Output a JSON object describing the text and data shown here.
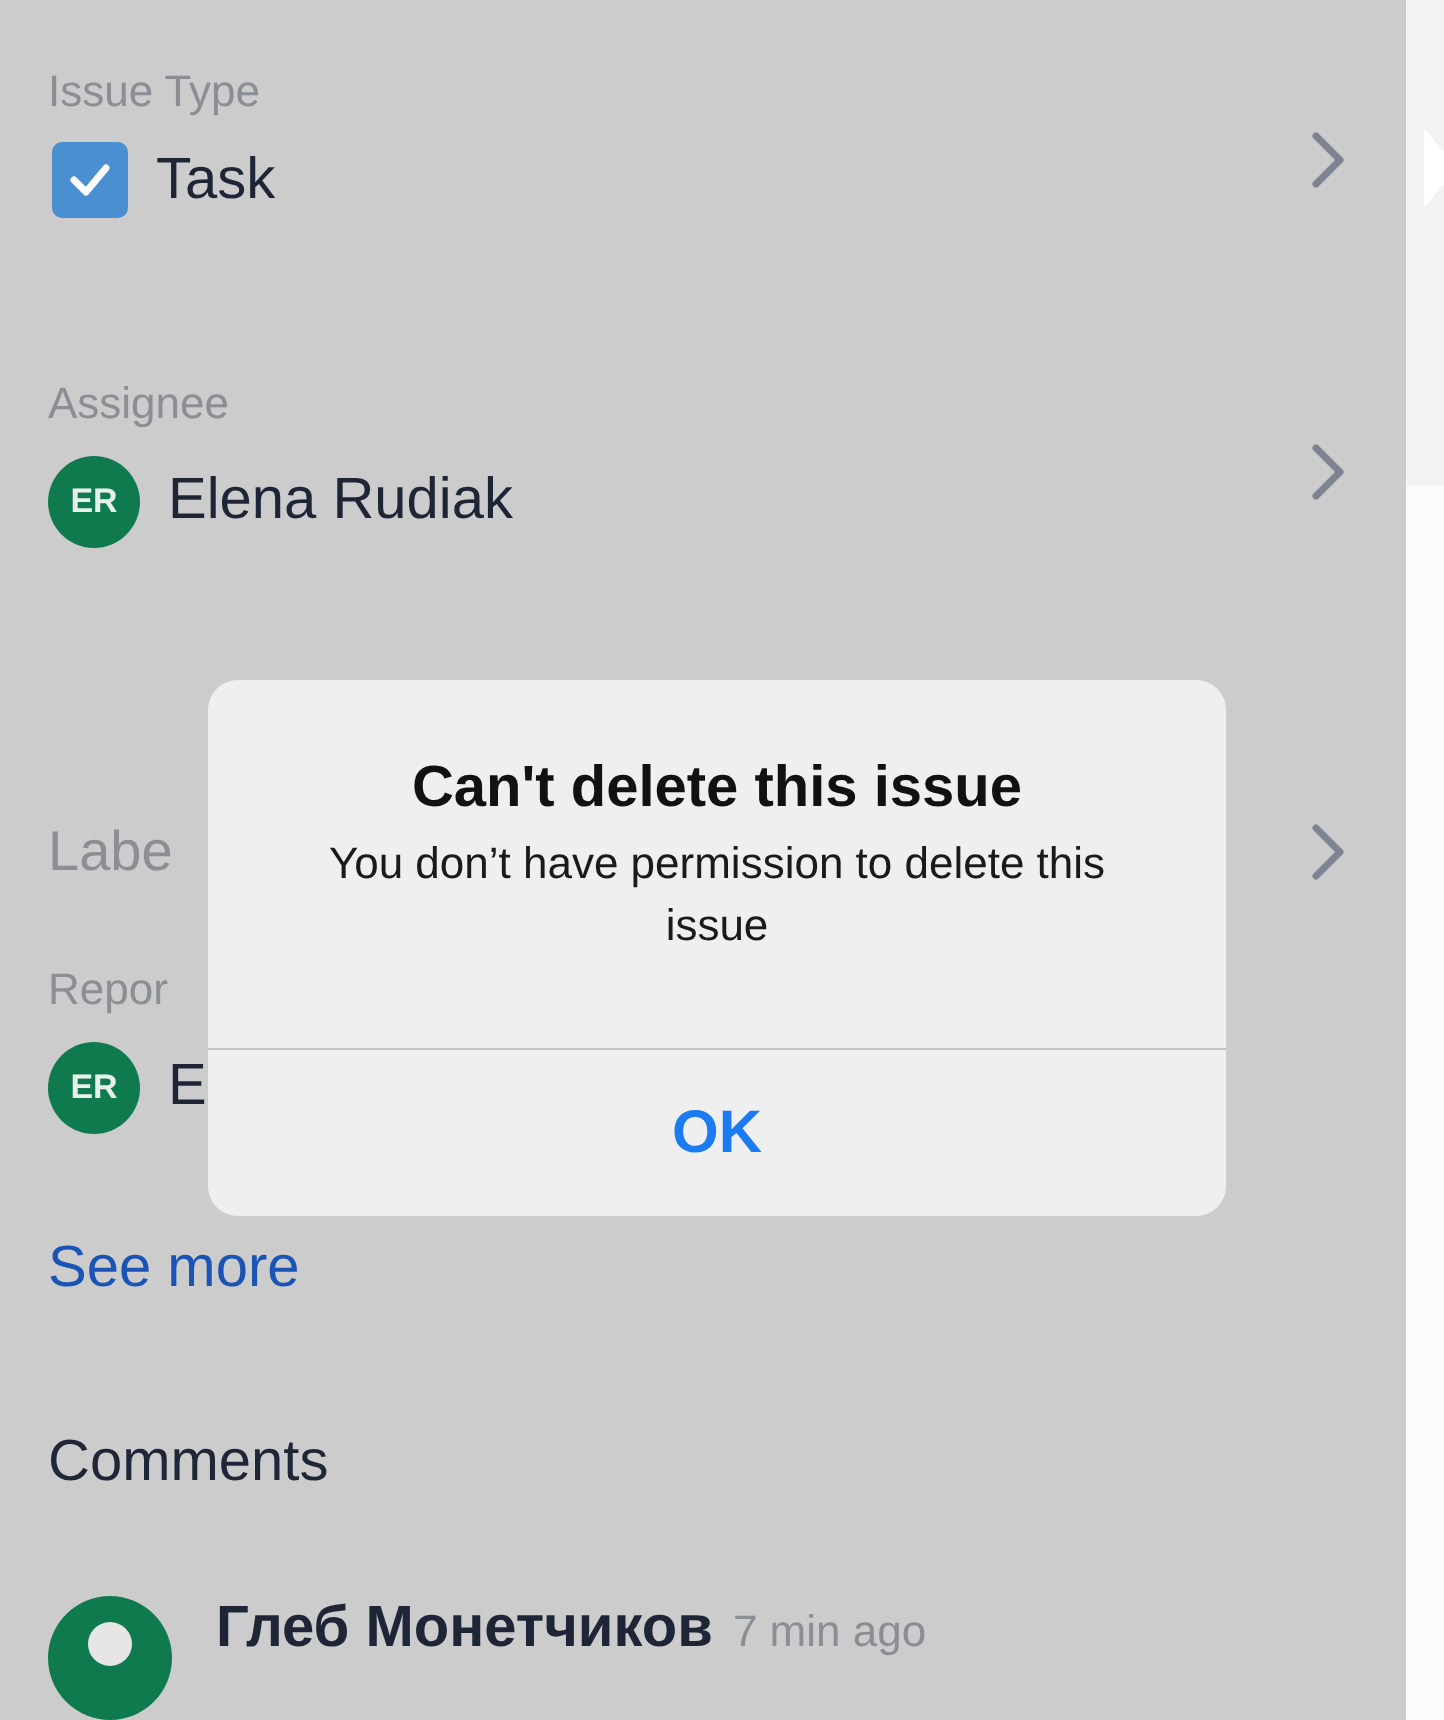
{
  "fields": [
    {
      "kind": "type",
      "label": "Issue Type",
      "value": "Task",
      "checked": true,
      "chevron": true
    },
    {
      "kind": "user",
      "label": "Assignee",
      "value": "Elena Rudiak",
      "avatar": "ER",
      "chevron": true
    },
    {
      "kind": "empty",
      "label": "Labe",
      "chevron": true
    },
    {
      "kind": "user",
      "label": "Repor",
      "value": "E",
      "avatar": "ER",
      "chevron": false
    }
  ],
  "see_more": "See more",
  "comments": {
    "title": "Comments",
    "items": [
      {
        "author": "Глеб Монетчиков",
        "time": "7 min ago"
      }
    ]
  },
  "dialog": {
    "title": "Can't delete this issue",
    "message": "You don’t have permission to delete this issue",
    "buttons": [
      "OK"
    ]
  }
}
